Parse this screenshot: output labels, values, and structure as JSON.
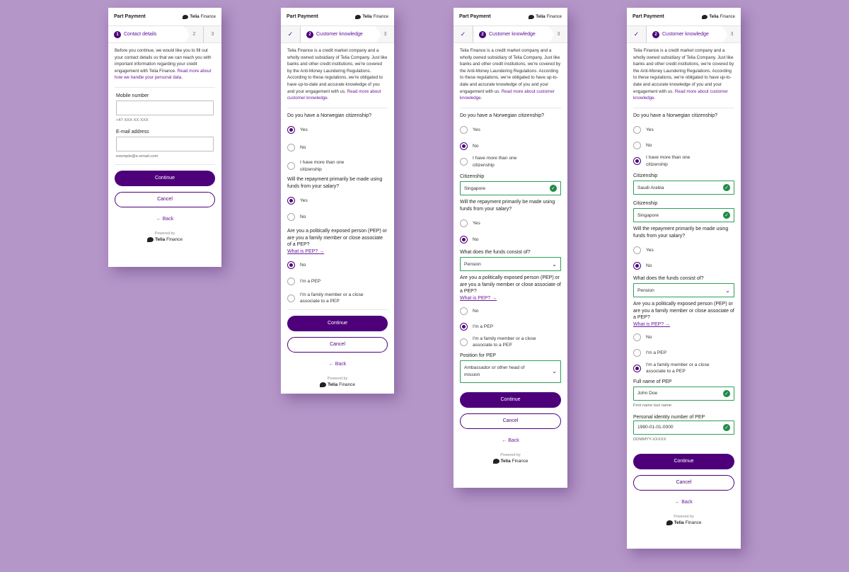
{
  "header": {
    "title": "Part Payment",
    "brand_bold": "Telia",
    "brand_rest": " Finance"
  },
  "common": {
    "continue": "Continue",
    "cancel": "Cancel",
    "back": "Back",
    "powered": "Powered by",
    "powered_brand_bold": "Telia",
    "powered_brand_rest": " Finance",
    "colors": {
      "primary": "#4d007a",
      "valid": "#1f8a46",
      "background": "#b596c9"
    }
  },
  "screen1": {
    "step1_num": "1",
    "step1_label": "Contact details",
    "step2": "2",
    "step3": "3",
    "intro": "Before you continue, we would like you to fill out your contact details so that we can reach you with important information regarding your credit engagement with Telia Finance.",
    "intro_link": "Read more about how we handle your personal data.",
    "mobile_label": "Mobile number",
    "mobile_value": "",
    "mobile_hint": "+47 XXX XX XXX",
    "email_label": "E-mail address",
    "email_value": "",
    "email_hint": "exemple@e-email.com"
  },
  "ck": {
    "step_done": "✓",
    "step2_num": "2",
    "step2_label": "Customer knowledge",
    "step3": "3",
    "intro": "Telia Finance is a credit market company and a wholly owned subsidiary of Telia Company. Just like banks and other credit institutions, we're covered by the Anti-Money Laundering Regulations. According to these regulations, we're obligated to have up-to-date and accurate knowledge of you and your engagement with us.",
    "intro_link": "Read more about customer knowledge.",
    "q_citizenship": "Do you have a Norwegian citizenship?",
    "opt_yes": "Yes",
    "opt_no": "No",
    "opt_multiple": "I have more than one citizenship",
    "citizenship_label": "Citizenship",
    "q_salary": "Will the repayment primarily be made using funds from your salary?",
    "funds_label": "What does the funds consist of?",
    "funds_value": "Pension",
    "q_pep": "Are you a politically exposed person (PEP) or are you a family member or close associate of a PEP?",
    "what_is_pep": "What is PEP?",
    "opt_pep": "I'm a PEP",
    "opt_pep_family": "I'm a family member or a close associate to a PEP",
    "position_label": "Position for PEP",
    "position_value": "Ambassador or other head of mission",
    "fullname_label": "Full name of PEP",
    "fullname_value": "John Doe",
    "fullname_hint": "First name last name",
    "pid_label": "Personal identity number of PEP",
    "pid_value": "1980-01-01-0000",
    "pid_hint": "DDMMYY-XXXXX"
  },
  "screen3": {
    "citizenship_value": "Singapore"
  },
  "screen4": {
    "citizenship1_value": "Saudi Arabia",
    "citizenship2_value": "Singapore"
  }
}
